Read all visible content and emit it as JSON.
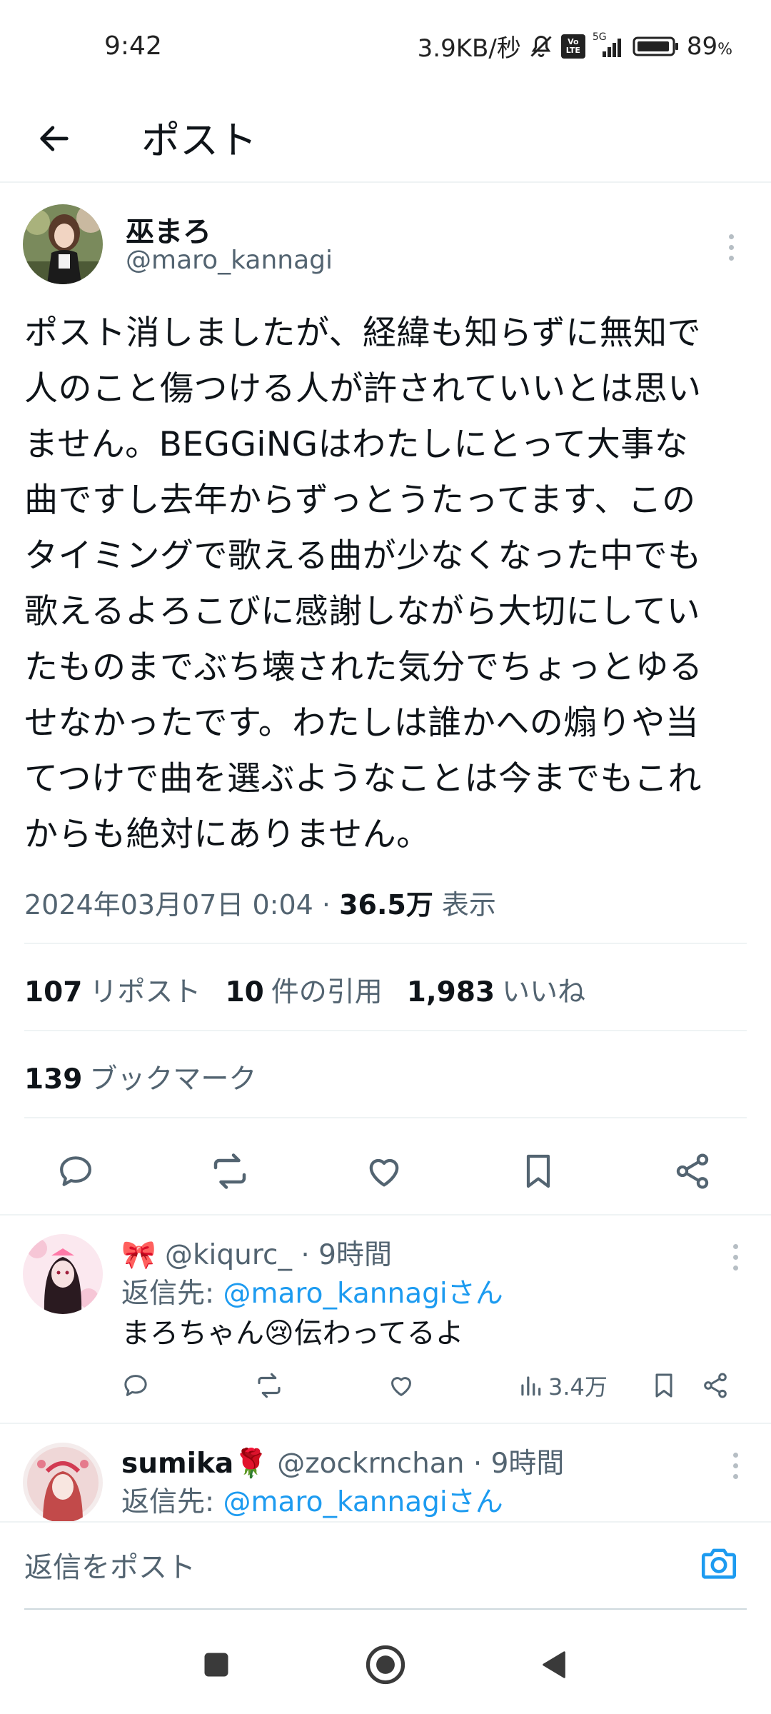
{
  "status_bar": {
    "time": "9:42",
    "network_speed": "3.9KB/秒",
    "volte": "Vo LTE",
    "signal_type": "5G",
    "battery": "89",
    "battery_unit": "%"
  },
  "header": {
    "title": "ポスト"
  },
  "post": {
    "author_name": "巫まろ",
    "author_handle": "@maro_kannagi",
    "text": "ポスト消しましたが、経緯も知らずに無知で\n人のこと傷つける人が許されていいとは思い\nません。BEGGiNGはわたしにとって大事な\n曲ですし去年からずっとうたってます、この\nタイミングで歌える曲が少なくなった中でも\n歌えるよろこびに感謝しながら大切にしてい\nたものまでぶち壊された気分でちょっとゆる\nせなかったです。わたしは誰かへの煽りや当\nてつけで曲を選ぶようなことは今までもこれ\nからも絶対にありません。",
    "timestamp": "2024年03月07日 0:04 · ",
    "views_count": "36.5万",
    "views_label": " 表示",
    "reposts_count": "107",
    "reposts_label": "リポスト",
    "quotes_count": "10",
    "quotes_label": "件の引用",
    "likes_count": "1,983",
    "likes_label": "いいね",
    "bookmarks_count": "139",
    "bookmarks_label": "ブックマーク"
  },
  "replies": [
    {
      "name_prefix": "🎀",
      "handle": "@kiqurc_",
      "time": " · 9時間",
      "reply_to_label": "返信先: ",
      "reply_to_handle": "@maro_kannagiさん",
      "text": "まろちゃん😢伝わってるよ",
      "views": "3.4万"
    },
    {
      "name": "sumika🌹",
      "handle": " @zockrnchan",
      "time": " · 9時間",
      "reply_to_label": "返信先: ",
      "reply_to_handle": "@maro_kannagiさん"
    }
  ],
  "reply_composer": {
    "placeholder": "返信をポスト"
  },
  "colors": {
    "accent": "#1d9bf0",
    "text_primary": "#0f1419",
    "text_secondary": "#536471",
    "divider": "#eff3f4"
  },
  "icons": {
    "back": "arrow-left-icon",
    "more": "more-vertical-icon",
    "reply": "speech-bubble-icon",
    "repost": "repost-icon",
    "like": "heart-icon",
    "bookmark": "bookmark-icon",
    "share": "share-icon",
    "views": "bar-chart-icon",
    "camera": "camera-icon"
  }
}
